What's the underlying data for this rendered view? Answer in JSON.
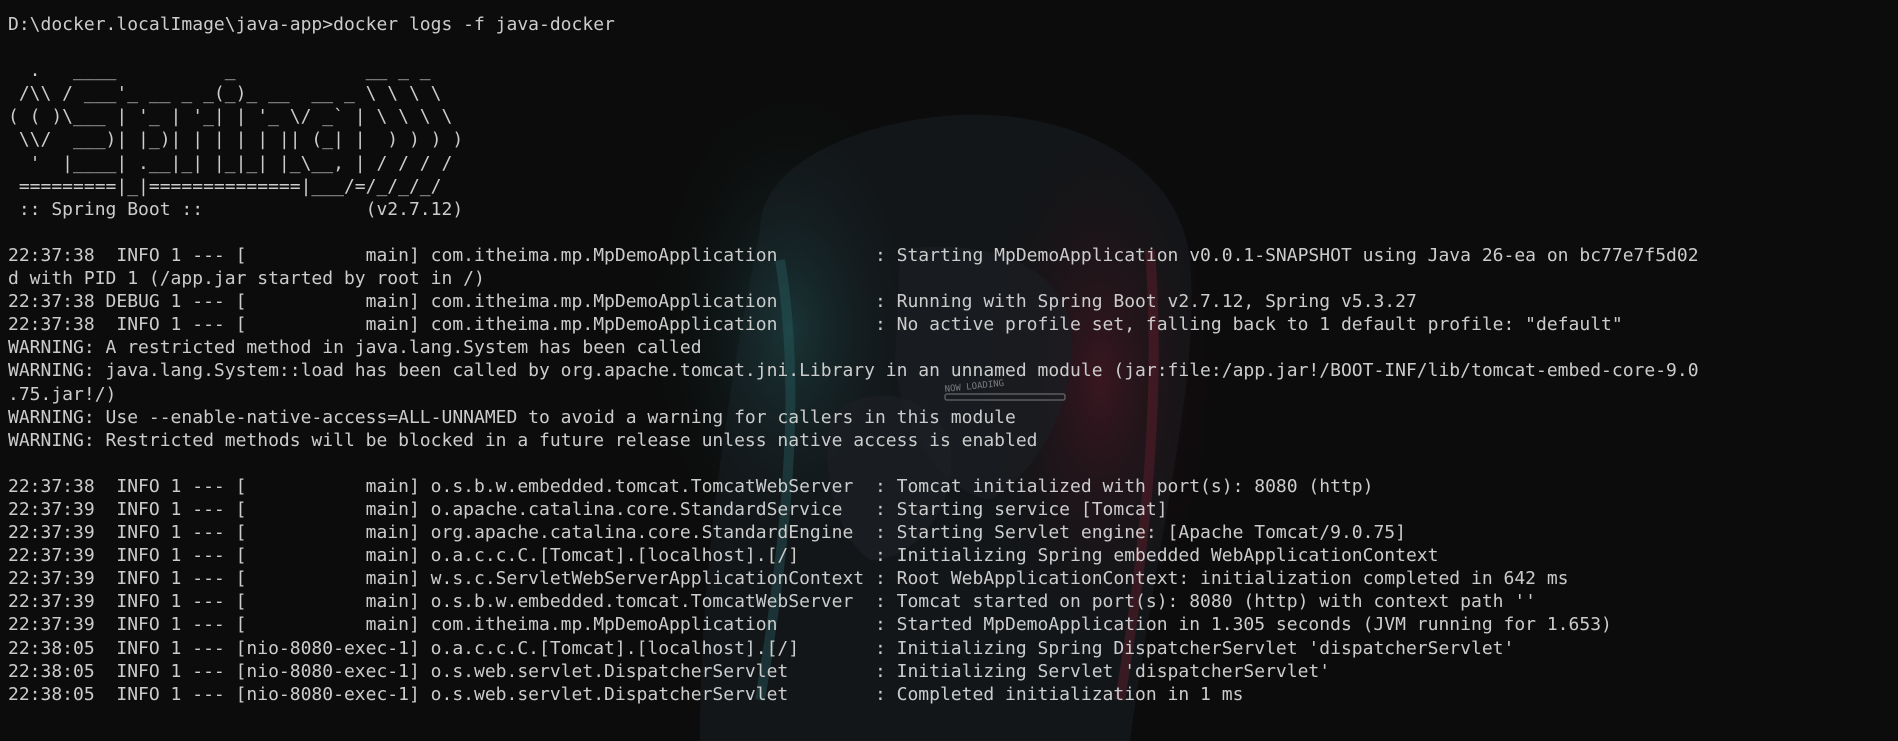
{
  "terminal": {
    "background_color": "#0c0c0c",
    "text_color": "#cccccc",
    "wallpaper_text": "NOW LOADING",
    "lines": [
      "D:\\docker.localImage\\java-app>docker logs -f java-docker",
      "",
      "  .   ____          _            __ _ _",
      " /\\\\ / ___'_ __ _ _(_)_ __  __ _ \\ \\ \\ \\",
      "( ( )\\___ | '_ | '_| | '_ \\/ _` | \\ \\ \\ \\",
      " \\\\/  ___)| |_)| | | | | || (_| |  ) ) ) )",
      "  '  |____| .__|_| |_|_| |_\\__, | / / / /",
      " =========|_|==============|___/=/_/_/_/",
      " :: Spring Boot ::               (v2.7.12)",
      "",
      "22:37:38  INFO 1 --- [           main] com.itheima.mp.MpDemoApplication         : Starting MpDemoApplication v0.0.1-SNAPSHOT using Java 26-ea on bc77e7f5d02",
      "d with PID 1 (/app.jar started by root in /)",
      "22:37:38 DEBUG 1 --- [           main] com.itheima.mp.MpDemoApplication         : Running with Spring Boot v2.7.12, Spring v5.3.27",
      "22:37:38  INFO 1 --- [           main] com.itheima.mp.MpDemoApplication         : No active profile set, falling back to 1 default profile: \"default\"",
      "WARNING: A restricted method in java.lang.System has been called",
      "WARNING: java.lang.System::load has been called by org.apache.tomcat.jni.Library in an unnamed module (jar:file:/app.jar!/BOOT-INF/lib/tomcat-embed-core-9.0",
      ".75.jar!/)",
      "WARNING: Use --enable-native-access=ALL-UNNAMED to avoid a warning for callers in this module",
      "WARNING: Restricted methods will be blocked in a future release unless native access is enabled",
      "",
      "22:37:38  INFO 1 --- [           main] o.s.b.w.embedded.tomcat.TomcatWebServer  : Tomcat initialized with port(s): 8080 (http)",
      "22:37:39  INFO 1 --- [           main] o.apache.catalina.core.StandardService   : Starting service [Tomcat]",
      "22:37:39  INFO 1 --- [           main] org.apache.catalina.core.StandardEngine  : Starting Servlet engine: [Apache Tomcat/9.0.75]",
      "22:37:39  INFO 1 --- [           main] o.a.c.c.C.[Tomcat].[localhost].[/]       : Initializing Spring embedded WebApplicationContext",
      "22:37:39  INFO 1 --- [           main] w.s.c.ServletWebServerApplicationContext : Root WebApplicationContext: initialization completed in 642 ms",
      "22:37:39  INFO 1 --- [           main] o.s.b.w.embedded.tomcat.TomcatWebServer  : Tomcat started on port(s): 8080 (http) with context path ''",
      "22:37:39  INFO 1 --- [           main] com.itheima.mp.MpDemoApplication         : Started MpDemoApplication in 1.305 seconds (JVM running for 1.653)",
      "22:38:05  INFO 1 --- [nio-8080-exec-1] o.a.c.c.C.[Tomcat].[localhost].[/]       : Initializing Spring DispatcherServlet 'dispatcherServlet'",
      "22:38:05  INFO 1 --- [nio-8080-exec-1] o.s.web.servlet.DispatcherServlet        : Initializing Servlet 'dispatcherServlet'",
      "22:38:05  INFO 1 --- [nio-8080-exec-1] o.s.web.servlet.DispatcherServlet        : Completed initialization in 1 ms"
    ]
  }
}
